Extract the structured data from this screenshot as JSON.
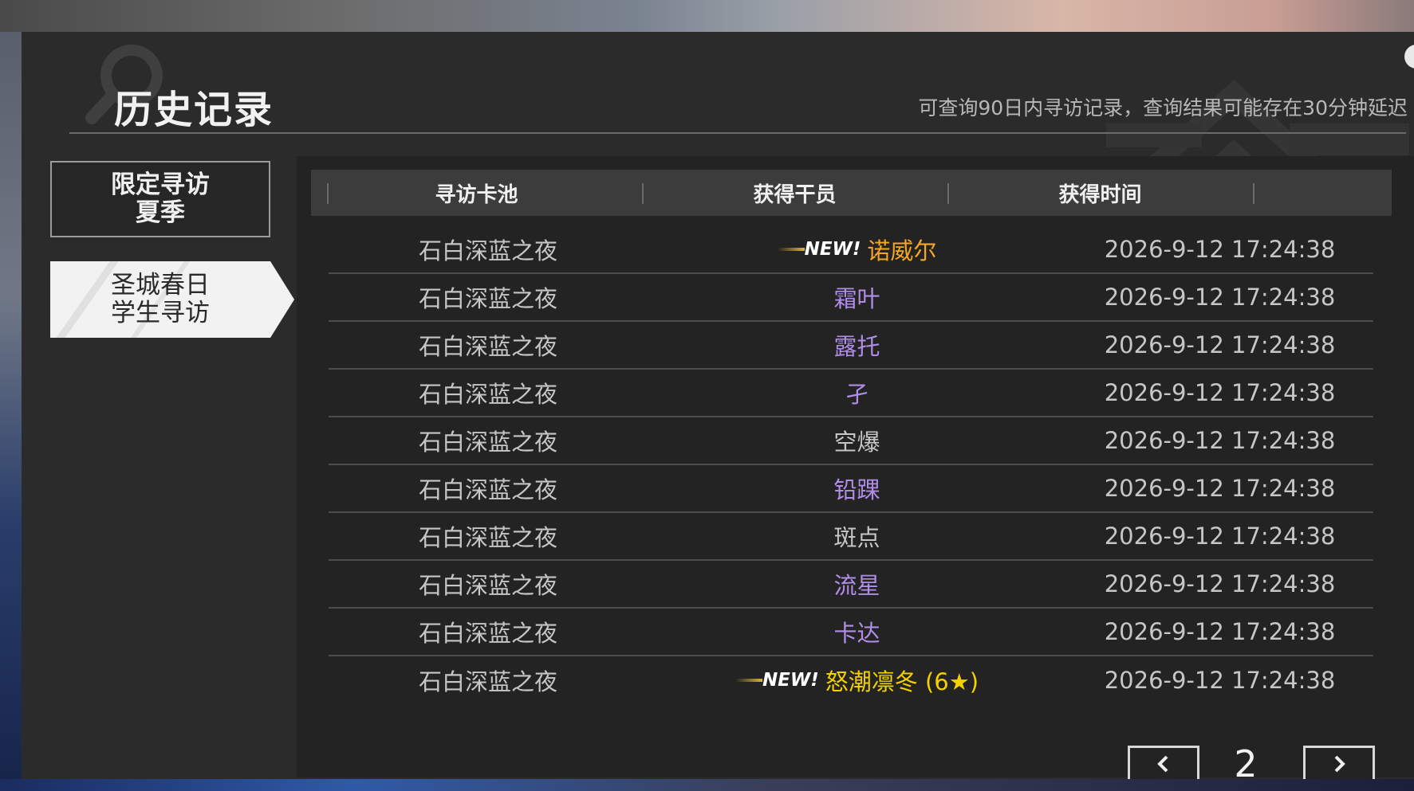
{
  "title": "历史记录",
  "notice": "可查询90日内寻访记录，查询结果可能存在30分钟延迟",
  "tabs": [
    {
      "line1": "限定寻访",
      "line2": "夏季",
      "selected": false
    },
    {
      "line1": "圣城春日",
      "line2": "学生寻访",
      "selected": true
    }
  ],
  "table": {
    "headers": [
      "寻访卡池",
      "获得干员",
      "获得时间"
    ],
    "new_label": "NEW!",
    "rows": [
      {
        "pool": "石白深蓝之夜",
        "operator": "诺威尔",
        "time": "2026-9-12 17:24:38",
        "is_new": true,
        "color": "#f5a623"
      },
      {
        "pool": "石白深蓝之夜",
        "operator": "霜叶",
        "time": "2026-9-12 17:24:38",
        "is_new": false,
        "color": "#b08ee8"
      },
      {
        "pool": "石白深蓝之夜",
        "operator": "露托",
        "time": "2026-9-12 17:24:38",
        "is_new": false,
        "color": "#b08ee8"
      },
      {
        "pool": "石白深蓝之夜",
        "operator": "孑",
        "time": "2026-9-12 17:24:38",
        "is_new": false,
        "color": "#b08ee8"
      },
      {
        "pool": "石白深蓝之夜",
        "operator": "空爆",
        "time": "2026-9-12 17:24:38",
        "is_new": false,
        "color": "#c6c6c6"
      },
      {
        "pool": "石白深蓝之夜",
        "operator": "铅踝",
        "time": "2026-9-12 17:24:38",
        "is_new": false,
        "color": "#b08ee8"
      },
      {
        "pool": "石白深蓝之夜",
        "operator": "斑点",
        "time": "2026-9-12 17:24:38",
        "is_new": false,
        "color": "#c6c6c6"
      },
      {
        "pool": "石白深蓝之夜",
        "operator": "流星",
        "time": "2026-9-12 17:24:38",
        "is_new": false,
        "color": "#b08ee8"
      },
      {
        "pool": "石白深蓝之夜",
        "operator": "卡达",
        "time": "2026-9-12 17:24:38",
        "is_new": false,
        "color": "#b08ee8"
      },
      {
        "pool": "石白深蓝之夜",
        "operator": "怒潮凛冬 (6★)",
        "time": "2026-9-12 17:24:38",
        "is_new": true,
        "color": "#f5d000"
      }
    ]
  },
  "pagination": {
    "current_page": "2"
  },
  "icons": {
    "decor": "search-icon",
    "prev": "chevron-left-icon",
    "next": "chevron-right-icon"
  }
}
